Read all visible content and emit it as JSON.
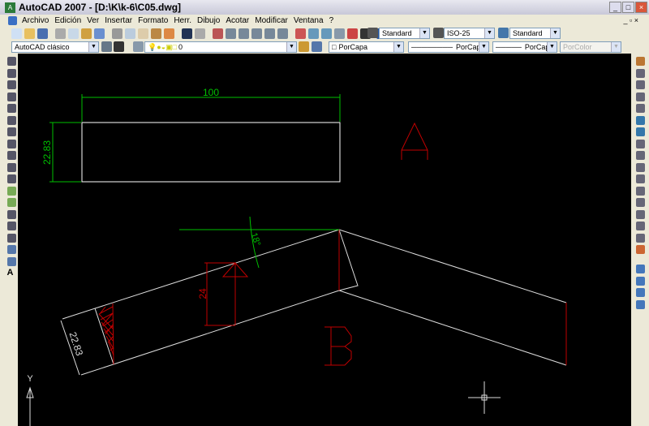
{
  "window": {
    "title": "AutoCAD 2007 - [D:\\K\\k-6\\C05.dwg]"
  },
  "menu": [
    "Archivo",
    "Edición",
    "Ver",
    "Insertar",
    "Formato",
    "Herr.",
    "Dibujo",
    "Acotar",
    "Modificar",
    "Ventana",
    "?"
  ],
  "toolbar": {
    "text_style": "Standard",
    "dim_style": "ISO-25",
    "table_style": "Standard",
    "workspace": "AutoCAD clásico",
    "layer": "0",
    "color": "PorCapa",
    "linetype": "PorCapa",
    "lineweight": "PorCapa",
    "plotstyle": "PorColor"
  },
  "drawing": {
    "dim_width": "100",
    "dim_height": "22.83",
    "dim_beam": "22.83",
    "dim_24": "24",
    "angle": "18°",
    "label_a": "A",
    "label_b": "B",
    "ucs_y": "Y"
  },
  "colors": {
    "canvas": "#000000",
    "dimension_green": "#00c000",
    "red": "#c00000",
    "white": "#ffffff"
  }
}
